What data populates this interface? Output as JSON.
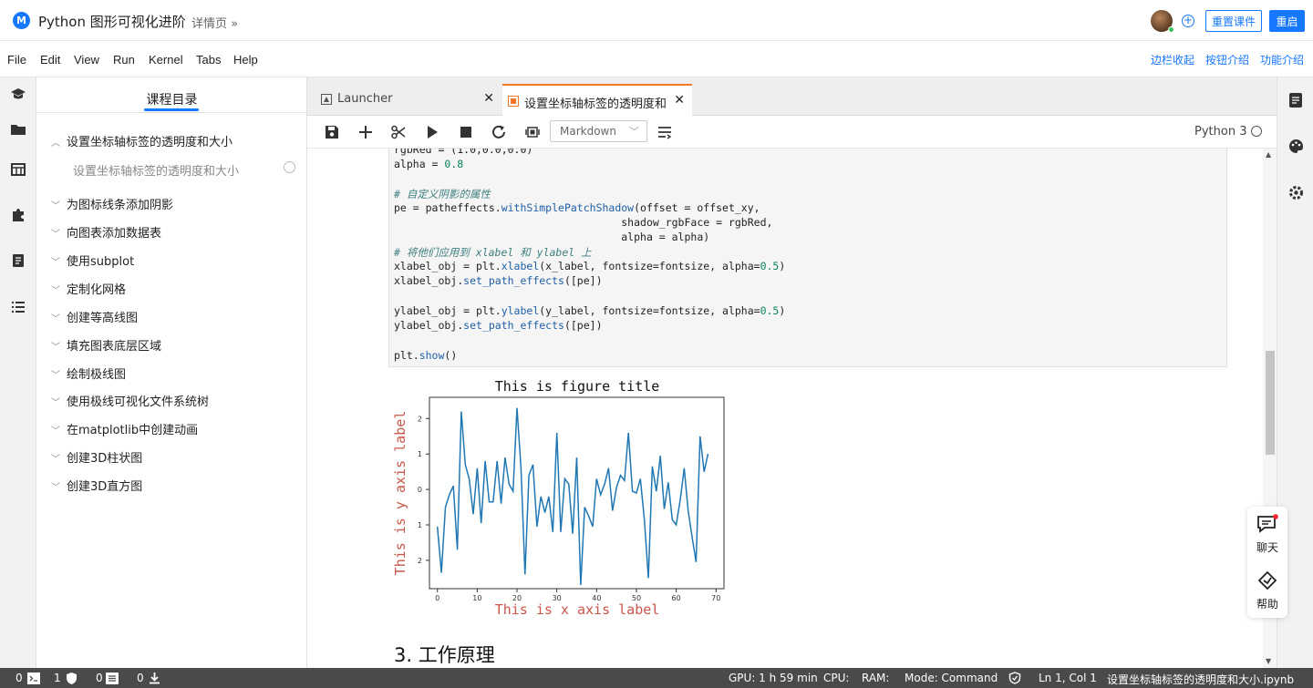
{
  "topbar": {
    "logo_letter": "M",
    "title": "Python 图形可视化进阶",
    "detail_link": "详情页 »",
    "reset_button": "重置课件",
    "restart_button": "重启"
  },
  "menu": {
    "items": [
      "File",
      "Edit",
      "View",
      "Run",
      "Kernel",
      "Tabs",
      "Help"
    ],
    "right_links": [
      "边栏收起",
      "按钮介绍",
      "功能介绍"
    ]
  },
  "toc": {
    "title": "课程目录",
    "items": [
      {
        "label": "设置坐标轴标签的透明度和大小",
        "expanded": true
      },
      {
        "label": "为图标线条添加阴影"
      },
      {
        "label": "向图表添加数据表"
      },
      {
        "label": "使用subplot"
      },
      {
        "label": "定制化网格"
      },
      {
        "label": "创建等高线图"
      },
      {
        "label": "填充图表底层区域"
      },
      {
        "label": "绘制极线图"
      },
      {
        "label": "使用极线可视化文件系统树"
      },
      {
        "label": "在matplotlib中创建动画"
      },
      {
        "label": "创建3D柱状图"
      },
      {
        "label": "创建3D直方图"
      }
    ],
    "sub_item": "设置坐标轴标签的透明度和大小"
  },
  "tabs": {
    "launcher": "Launcher",
    "notebook": "设置坐标轴标签的透明度和大小.ipynb"
  },
  "toolbar": {
    "cell_type": "Markdown",
    "kernel": "Python 3"
  },
  "code": {
    "line0": "rgbRed = (1.0,0.0,0.0)",
    "line1_a": "alpha = ",
    "line1_b": "0.8",
    "comment1": "# 自定义阴影的属性",
    "pe_a": "pe = patheffects.",
    "pe_fn": "withSimplePatchShadow",
    "pe_b": "(offset = offset_xy,",
    "pe_l2": "                                    shadow_rgbFace = rgbRed,",
    "pe_l3": "                                    alpha = alpha)",
    "comment2": "# 将他们应用到 xlabel 和 ylabel 上",
    "xl_a": "xlabel_obj = plt.",
    "xl_fn": "xlabel",
    "xl_b": "(x_label, fontsize=fontsize, alpha=",
    "xl_num": "0.5",
    "xl_c": ")",
    "xs_a": "xlabel_obj.",
    "xs_fn": "set_path_effects",
    "xs_b": "([pe])",
    "yl_a": "ylabel_obj = plt.",
    "yl_fn": "ylabel",
    "yl_b": "(y_label, fontsize=fontsize, alpha=",
    "yl_num": "0.5",
    "yl_c": ")",
    "ys_a": "ylabel_obj.",
    "ys_fn": "set_path_effects",
    "ys_b": "([pe])",
    "show_a": "plt.",
    "show_fn": "show",
    "show_b": "()"
  },
  "chart_data": {
    "type": "line",
    "title": "This is figure title",
    "xlabel": "This is x axis label",
    "ylabel": "This is y axis label",
    "xlim": [
      -2,
      72
    ],
    "ylim": [
      -2.8,
      2.6
    ],
    "xticks": [
      0,
      10,
      20,
      30,
      40,
      50,
      60,
      70
    ],
    "yticks": [
      2,
      1,
      0,
      -1,
      -2
    ],
    "ytick_labels": [
      "2",
      "1",
      "0",
      "1",
      "2"
    ],
    "label_color": "#c0392b",
    "line_color": "#1f77b4",
    "x": [
      0,
      1,
      2,
      3,
      4,
      5,
      6,
      7,
      8,
      9,
      10,
      11,
      12,
      13,
      14,
      15,
      16,
      17,
      18,
      19,
      20,
      21,
      22,
      23,
      24,
      25,
      26,
      27,
      28,
      29,
      30,
      31,
      32,
      33,
      34,
      35,
      36,
      37,
      38,
      39,
      40,
      41,
      42,
      43,
      44,
      45,
      46,
      47,
      48,
      49,
      50,
      51,
      52,
      53,
      54,
      55,
      56,
      57,
      58,
      59,
      60,
      61,
      62,
      63,
      64,
      65,
      66,
      67,
      68,
      69
    ],
    "values": [
      -1.05,
      -2.35,
      -0.5,
      -0.15,
      0.1,
      -1.7,
      2.2,
      0.7,
      0.3,
      -0.7,
      0.6,
      -0.95,
      0.8,
      -0.35,
      -0.35,
      0.8,
      -0.4,
      0.9,
      0.15,
      -0.05,
      2.3,
      0.6,
      -2.4,
      0.4,
      0.7,
      -1.05,
      -0.2,
      -0.65,
      -0.2,
      -1.2,
      1.6,
      -1.2,
      0.3,
      0.15,
      -1.25,
      0.9,
      -2.7,
      -0.5,
      -0.75,
      -1.05,
      0.3,
      -0.15,
      0.15,
      0.6,
      -0.6,
      0.05,
      0.4,
      0.25,
      1.6,
      -0.05,
      -0.1,
      0.3,
      -0.85,
      -2.5,
      0.65,
      -0.05,
      0.95,
      -0.55,
      0.2,
      -0.85,
      -1.0,
      -0.3,
      0.6,
      -0.6,
      -1.35,
      -2.05,
      1.5,
      0.5,
      1.0,
      null
    ]
  },
  "notebook_section": "3. 工作原理",
  "floating": {
    "chat": "聊天",
    "help": "帮助"
  },
  "statusbar": {
    "terminals": "0",
    "kernels": "1",
    "consoles": "0",
    "downloads": "0",
    "gpu": "GPU: 1 h 59 min",
    "cpu": "CPU:",
    "ram": "RAM:",
    "mode": "Mode: Command",
    "position": "Ln 1, Col 1",
    "filename": "设置坐标轴标签的透明度和大小.ipynb"
  }
}
